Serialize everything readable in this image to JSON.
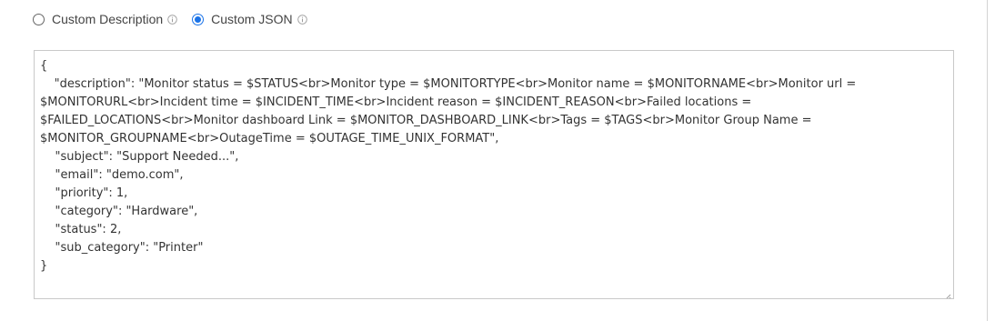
{
  "description_mode": {
    "options": [
      {
        "label": "Custom Description",
        "selected": false
      },
      {
        "label": "Custom JSON",
        "selected": true
      }
    ]
  },
  "colors": {
    "accent": "#1a73e8",
    "border": "#c9c9c9",
    "text": "#333333"
  },
  "json_editor": {
    "lines": [
      "{",
      "    \"description\": \"Monitor status = $STATUS<br>Monitor type = $MONITORTYPE<br>Monitor name = $MONITORNAME<br>Monitor url = $MONITORURL<br>Incident time = $INCIDENT_TIME<br>Incident reason = $INCIDENT_REASON<br>Failed locations = $FAILED_LOCATIONS<br>Monitor dashboard Link = $MONITOR_DASHBOARD_LINK<br>Tags = $TAGS<br>Monitor Group Name = $MONITOR_GROUPNAME<br>OutageTime = $OUTAGE_TIME_UNIX_FORMAT\",",
      "",
      "    \"subject\": \"Support Needed...\",",
      "    \"email\": \"demo.com\",",
      "    \"priority\": 1,",
      "    \"category\": \"Hardware\",",
      "    \"status\": 2,",
      "    \"sub_category\": \"Printer\"",
      "}"
    ]
  }
}
